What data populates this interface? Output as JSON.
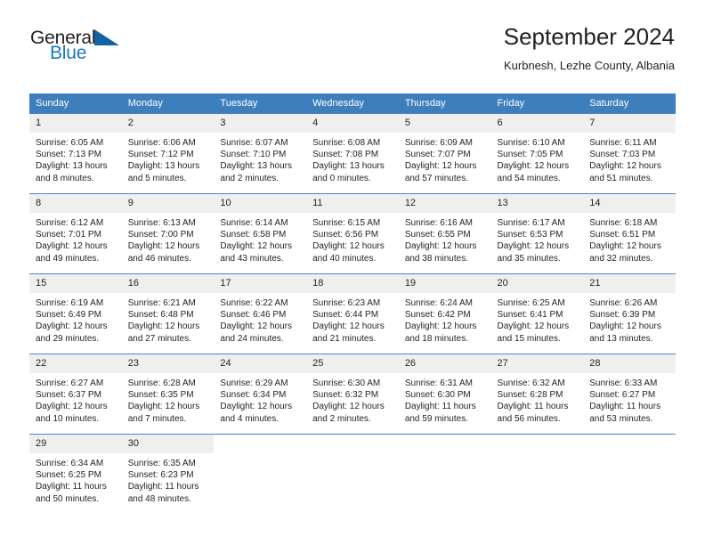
{
  "brand": {
    "name_part1": "General",
    "name_part2": "Blue",
    "triangle_color": "#1163a6",
    "blue_color": "#1878be"
  },
  "header": {
    "title": "September 2024",
    "subtitle": "Kurbnesh, Lezhe County, Albania"
  },
  "theme": {
    "header_bg": "#3d7ebd",
    "header_text": "#ffffff",
    "daynum_bg": "#efefef",
    "cell_border": "#4a86c8",
    "text": "#231f20"
  },
  "weekday_headers": [
    "Sunday",
    "Monday",
    "Tuesday",
    "Wednesday",
    "Thursday",
    "Friday",
    "Saturday"
  ],
  "labels": {
    "sunrise_prefix": "Sunrise: ",
    "sunset_prefix": "Sunset: ",
    "daylight_prefix": "Daylight: "
  },
  "weeks": [
    [
      {
        "day": "1",
        "sunrise": "Sunrise: 6:05 AM",
        "sunset": "Sunset: 7:13 PM",
        "daylight": "Daylight: 13 hours and 8 minutes."
      },
      {
        "day": "2",
        "sunrise": "Sunrise: 6:06 AM",
        "sunset": "Sunset: 7:12 PM",
        "daylight": "Daylight: 13 hours and 5 minutes."
      },
      {
        "day": "3",
        "sunrise": "Sunrise: 6:07 AM",
        "sunset": "Sunset: 7:10 PM",
        "daylight": "Daylight: 13 hours and 2 minutes."
      },
      {
        "day": "4",
        "sunrise": "Sunrise: 6:08 AM",
        "sunset": "Sunset: 7:08 PM",
        "daylight": "Daylight: 13 hours and 0 minutes."
      },
      {
        "day": "5",
        "sunrise": "Sunrise: 6:09 AM",
        "sunset": "Sunset: 7:07 PM",
        "daylight": "Daylight: 12 hours and 57 minutes."
      },
      {
        "day": "6",
        "sunrise": "Sunrise: 6:10 AM",
        "sunset": "Sunset: 7:05 PM",
        "daylight": "Daylight: 12 hours and 54 minutes."
      },
      {
        "day": "7",
        "sunrise": "Sunrise: 6:11 AM",
        "sunset": "Sunset: 7:03 PM",
        "daylight": "Daylight: 12 hours and 51 minutes."
      }
    ],
    [
      {
        "day": "8",
        "sunrise": "Sunrise: 6:12 AM",
        "sunset": "Sunset: 7:01 PM",
        "daylight": "Daylight: 12 hours and 49 minutes."
      },
      {
        "day": "9",
        "sunrise": "Sunrise: 6:13 AM",
        "sunset": "Sunset: 7:00 PM",
        "daylight": "Daylight: 12 hours and 46 minutes."
      },
      {
        "day": "10",
        "sunrise": "Sunrise: 6:14 AM",
        "sunset": "Sunset: 6:58 PM",
        "daylight": "Daylight: 12 hours and 43 minutes."
      },
      {
        "day": "11",
        "sunrise": "Sunrise: 6:15 AM",
        "sunset": "Sunset: 6:56 PM",
        "daylight": "Daylight: 12 hours and 40 minutes."
      },
      {
        "day": "12",
        "sunrise": "Sunrise: 6:16 AM",
        "sunset": "Sunset: 6:55 PM",
        "daylight": "Daylight: 12 hours and 38 minutes."
      },
      {
        "day": "13",
        "sunrise": "Sunrise: 6:17 AM",
        "sunset": "Sunset: 6:53 PM",
        "daylight": "Daylight: 12 hours and 35 minutes."
      },
      {
        "day": "14",
        "sunrise": "Sunrise: 6:18 AM",
        "sunset": "Sunset: 6:51 PM",
        "daylight": "Daylight: 12 hours and 32 minutes."
      }
    ],
    [
      {
        "day": "15",
        "sunrise": "Sunrise: 6:19 AM",
        "sunset": "Sunset: 6:49 PM",
        "daylight": "Daylight: 12 hours and 29 minutes."
      },
      {
        "day": "16",
        "sunrise": "Sunrise: 6:21 AM",
        "sunset": "Sunset: 6:48 PM",
        "daylight": "Daylight: 12 hours and 27 minutes."
      },
      {
        "day": "17",
        "sunrise": "Sunrise: 6:22 AM",
        "sunset": "Sunset: 6:46 PM",
        "daylight": "Daylight: 12 hours and 24 minutes."
      },
      {
        "day": "18",
        "sunrise": "Sunrise: 6:23 AM",
        "sunset": "Sunset: 6:44 PM",
        "daylight": "Daylight: 12 hours and 21 minutes."
      },
      {
        "day": "19",
        "sunrise": "Sunrise: 6:24 AM",
        "sunset": "Sunset: 6:42 PM",
        "daylight": "Daylight: 12 hours and 18 minutes."
      },
      {
        "day": "20",
        "sunrise": "Sunrise: 6:25 AM",
        "sunset": "Sunset: 6:41 PM",
        "daylight": "Daylight: 12 hours and 15 minutes."
      },
      {
        "day": "21",
        "sunrise": "Sunrise: 6:26 AM",
        "sunset": "Sunset: 6:39 PM",
        "daylight": "Daylight: 12 hours and 13 minutes."
      }
    ],
    [
      {
        "day": "22",
        "sunrise": "Sunrise: 6:27 AM",
        "sunset": "Sunset: 6:37 PM",
        "daylight": "Daylight: 12 hours and 10 minutes."
      },
      {
        "day": "23",
        "sunrise": "Sunrise: 6:28 AM",
        "sunset": "Sunset: 6:35 PM",
        "daylight": "Daylight: 12 hours and 7 minutes."
      },
      {
        "day": "24",
        "sunrise": "Sunrise: 6:29 AM",
        "sunset": "Sunset: 6:34 PM",
        "daylight": "Daylight: 12 hours and 4 minutes."
      },
      {
        "day": "25",
        "sunrise": "Sunrise: 6:30 AM",
        "sunset": "Sunset: 6:32 PM",
        "daylight": "Daylight: 12 hours and 2 minutes."
      },
      {
        "day": "26",
        "sunrise": "Sunrise: 6:31 AM",
        "sunset": "Sunset: 6:30 PM",
        "daylight": "Daylight: 11 hours and 59 minutes."
      },
      {
        "day": "27",
        "sunrise": "Sunrise: 6:32 AM",
        "sunset": "Sunset: 6:28 PM",
        "daylight": "Daylight: 11 hours and 56 minutes."
      },
      {
        "day": "28",
        "sunrise": "Sunrise: 6:33 AM",
        "sunset": "Sunset: 6:27 PM",
        "daylight": "Daylight: 11 hours and 53 minutes."
      }
    ],
    [
      {
        "day": "29",
        "sunrise": "Sunrise: 6:34 AM",
        "sunset": "Sunset: 6:25 PM",
        "daylight": "Daylight: 11 hours and 50 minutes."
      },
      {
        "day": "30",
        "sunrise": "Sunrise: 6:35 AM",
        "sunset": "Sunset: 6:23 PM",
        "daylight": "Daylight: 11 hours and 48 minutes."
      },
      {
        "day": "",
        "sunrise": "",
        "sunset": "",
        "daylight": ""
      },
      {
        "day": "",
        "sunrise": "",
        "sunset": "",
        "daylight": ""
      },
      {
        "day": "",
        "sunrise": "",
        "sunset": "",
        "daylight": ""
      },
      {
        "day": "",
        "sunrise": "",
        "sunset": "",
        "daylight": ""
      },
      {
        "day": "",
        "sunrise": "",
        "sunset": "",
        "daylight": ""
      }
    ]
  ]
}
